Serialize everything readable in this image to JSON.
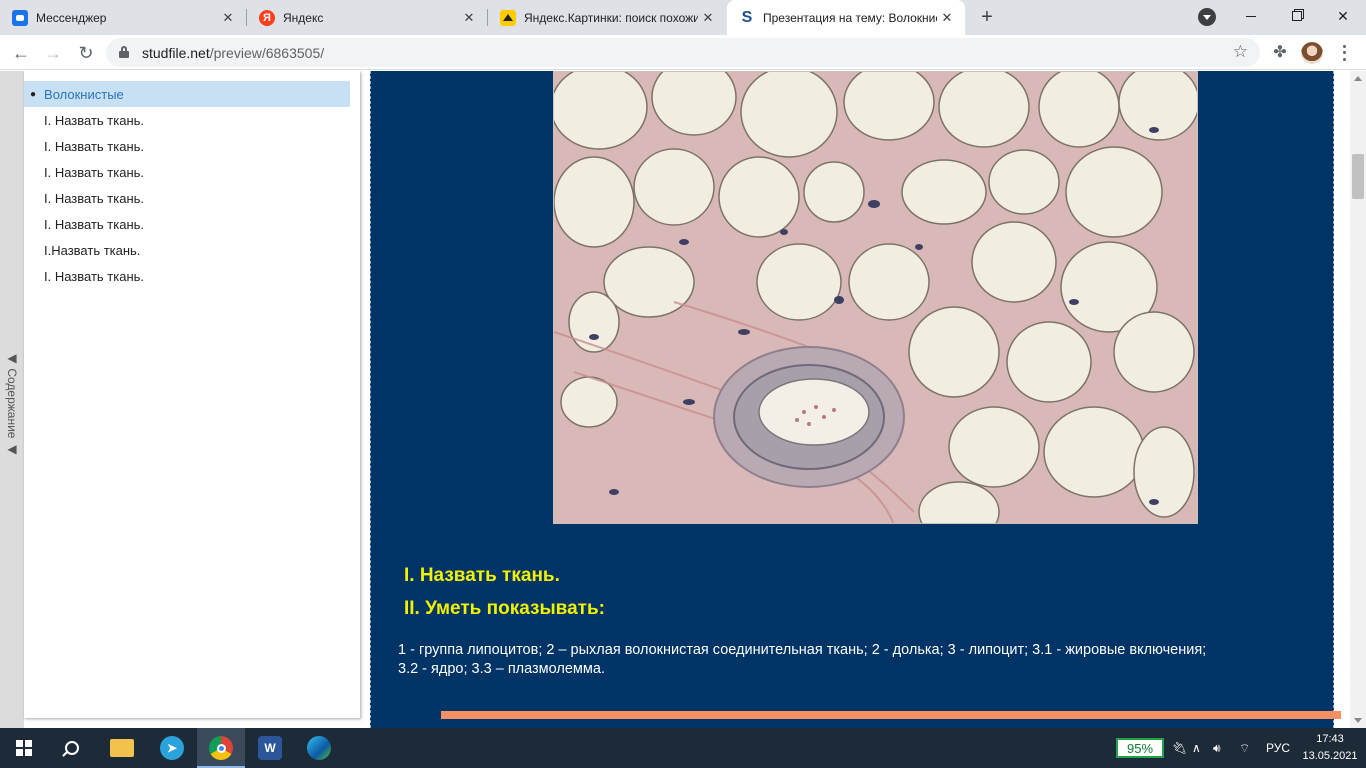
{
  "tabs": [
    {
      "title": "Мессенджер",
      "icon": "messenger-icon",
      "color": "#1a73e8"
    },
    {
      "title": "Яндекс",
      "icon": "yandex-icon",
      "color": "#fc3f1d"
    },
    {
      "title": "Яндекс.Картинки: поиск похожи",
      "icon": "yandex-images-icon",
      "color": "#ffcc00"
    },
    {
      "title": "Презентация на тему: Волокнис",
      "icon": "studfile-icon",
      "color": "#1b4f8a",
      "active": true
    }
  ],
  "toolbar": {
    "url_host": "studfile.net",
    "url_path": "/preview/6863505/"
  },
  "toc": {
    "handle_label": "◀ Содержание ◀",
    "items": [
      {
        "label": "Волокнистые",
        "selected": true
      },
      {
        "label": "I. Назвать ткань."
      },
      {
        "label": "I. Назвать ткань."
      },
      {
        "label": "I. Назвать ткань."
      },
      {
        "label": "I. Назвать ткань."
      },
      {
        "label": "I. Назвать ткань."
      },
      {
        "label": "I.Назвать ткань."
      },
      {
        "label": "I. Назвать ткань."
      }
    ]
  },
  "slide": {
    "heading1": "I. Назвать ткань.",
    "heading2": "II. Уметь показывать:",
    "description": "1 - группа липоцитов; 2 – рыхлая волокнистая соединительная ткань; 2 - долька; 3 - липоцит; 3.1 - жировые включения; 3.2 - ядро; 3.3 – плазмолемма.",
    "background": "#003366",
    "heading_color": "#f2f200",
    "accent_bar": "#f59062"
  },
  "taskbar": {
    "apps": [
      "windows-start-icon",
      "search-icon",
      "file-explorer-icon",
      "telegram-icon",
      "chrome-icon",
      "word-icon",
      "edge-icon"
    ],
    "battery": "95%",
    "language": "РУС",
    "time": "17:43",
    "date": "13.05.2021"
  }
}
